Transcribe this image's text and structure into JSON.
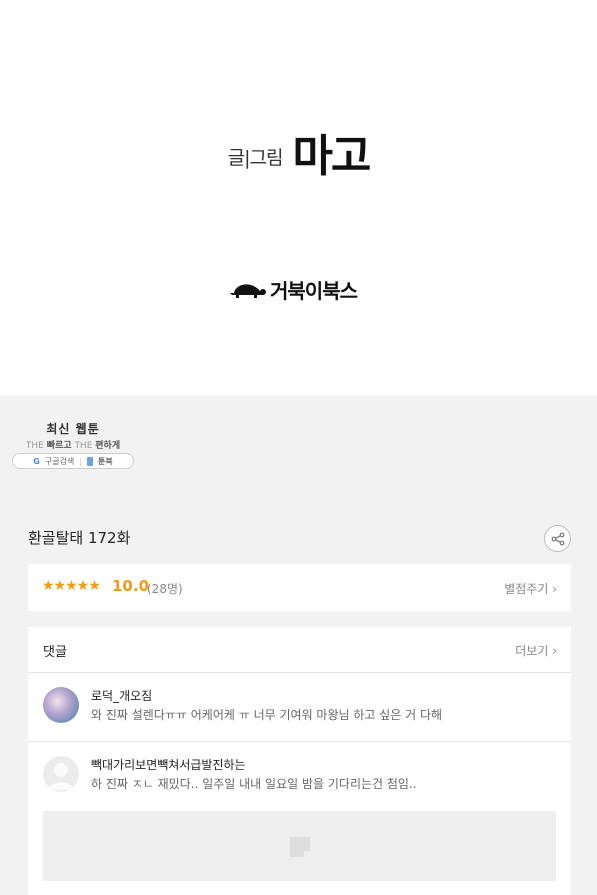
{
  "hero": {
    "credit_label": "글|그림",
    "author": "마고",
    "publisher": "거북이북스"
  },
  "promo": {
    "title": "최신 웹툰",
    "tagline_the1": "THE",
    "tagline_word1": "빠르고",
    "tagline_the2": "THE",
    "tagline_word2": "편하게",
    "search_label": "구글검색",
    "brand": "툰북"
  },
  "episode": {
    "title": "환골탈태 172화",
    "share_icon": "share-icon"
  },
  "rating": {
    "stars": "★★★★★",
    "score": "10.0",
    "count": "(28명)",
    "rate_label": "별점주기 ›"
  },
  "comments": {
    "title": "댓글",
    "more_label": "더보기 ›",
    "items": [
      {
        "author": "로덕_개오짐",
        "text": "와 진짜 설렌다ㅠㅠ 어케어케 ㅠ 너무 기여워 마왕님 하고 싶은 거 다해"
      },
      {
        "author": "빽대가리보면빽쳐서급발진하는",
        "text": "하 진짜 ㅈㄴ 재밌다.. 일주일 내내 일요일 밤을 기다리는건 첨임.."
      }
    ]
  }
}
